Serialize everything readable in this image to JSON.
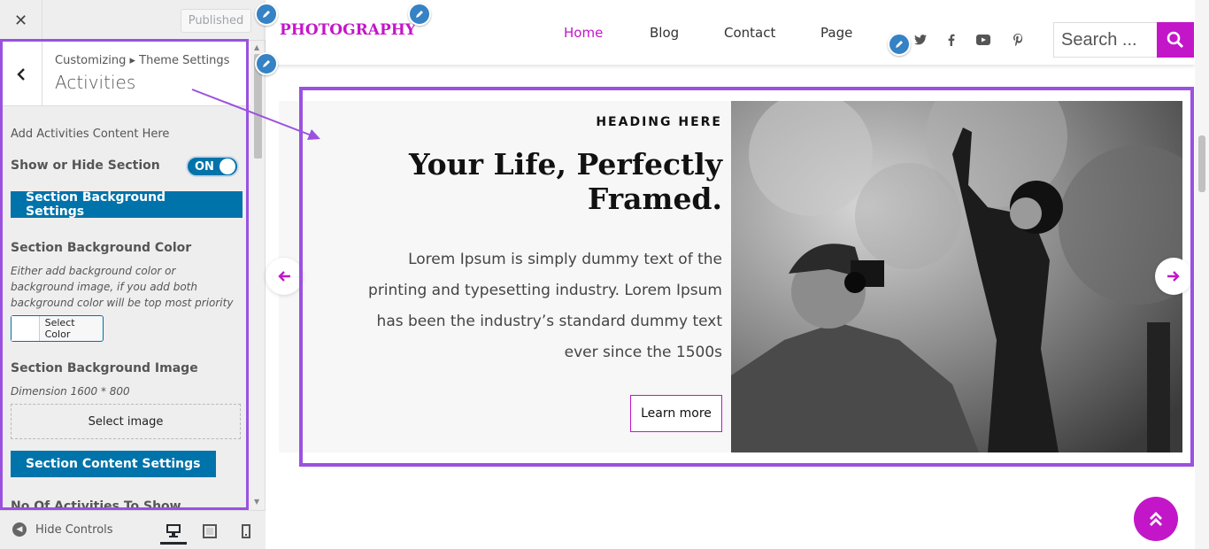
{
  "customizer": {
    "close_label": "✕",
    "publish_label": "Published",
    "breadcrumb": "Customizing ▸ Theme Settings",
    "panel_title": "Activities",
    "intro": "Add Activities Content Here",
    "show_hide_label": "Show or Hide Section",
    "toggle_state": "ON",
    "bg_settings_button": "Section Background Settings",
    "bg_color_label": "Section Background Color",
    "bg_color_desc": "Either add background color or background image, if you add both background color will be top most priority",
    "select_color_label": "Select Color",
    "bg_image_label": "Section Background Image",
    "bg_image_dimension": "Dimension 1600 * 800",
    "select_image_label": "Select image",
    "content_settings_button": "Section Content Settings",
    "next_setting_label": "No Of Activities To Show",
    "hide_controls_label": "Hide Controls"
  },
  "site": {
    "logo": "PHOTOGRAPHY",
    "nav": [
      "Home",
      "Blog",
      "Contact",
      "Page"
    ],
    "active_nav": "Home",
    "search_placeholder": "Search ...",
    "social_icons": [
      "twitter-icon",
      "facebook-icon",
      "youtube-icon",
      "pinterest-icon"
    ],
    "brand_color": "#c316c9",
    "highlight_color": "#9b51e0"
  },
  "slide": {
    "kicker": "HEADING HERE",
    "heading": "Your Life, Perfectly Framed.",
    "body": "Lorem Ipsum is simply dummy text of the printing and typesetting industry. Lorem Ipsum has been the industry’s standard dummy text ever since the 1500s",
    "cta": "Learn more"
  }
}
